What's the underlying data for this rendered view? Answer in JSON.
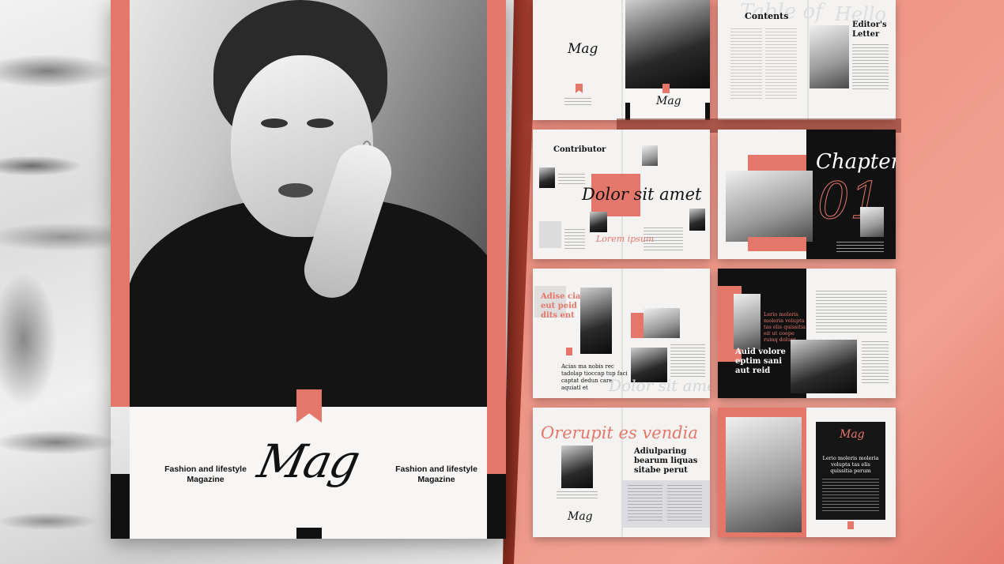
{
  "cover": {
    "tagline_left": "Fashion and lifestyle Magazine",
    "tagline_right": "Fashion and lifestyle Magazine",
    "logo": "Mag"
  },
  "spreads": {
    "s1": {
      "logo": "Mag",
      "bottom_logo": "Mag"
    },
    "s2": {
      "title": "Contents",
      "bg_word": "Table of",
      "editor_title": "Editor's Letter",
      "editor_bg": "Hello"
    },
    "s3": {
      "title": "Contributor",
      "headline": "Dolor sit amet",
      "script": "Lorem ipsum"
    },
    "s4": {
      "title": "Chapter",
      "number": "01"
    },
    "s5": {
      "headline": "Adise cia eut peid dits ent",
      "body": "Acias ma nobis rec tadolap tioccap tup faci captat dedun care aquiatl et",
      "ghost": "Dolor sit amet"
    },
    "s6": {
      "coral_text": "Lerio moleris moleria volupta tas elis quissitia eit ut coepe rumq dolupt",
      "headline": "Auid volore eptim sani aut reid"
    },
    "s7": {
      "headline": "Orerupit es vendia",
      "subhead": "Adiulparing bearum liquas sitabe perut",
      "logo": "Mag"
    },
    "s8": {
      "logo": "Mag",
      "body": "Lerio moleris moleria volupta tas elis quissitia perum"
    }
  },
  "colors": {
    "accent": "#e5776a",
    "dark": "#111111",
    "paper": "#f4f3f2"
  }
}
